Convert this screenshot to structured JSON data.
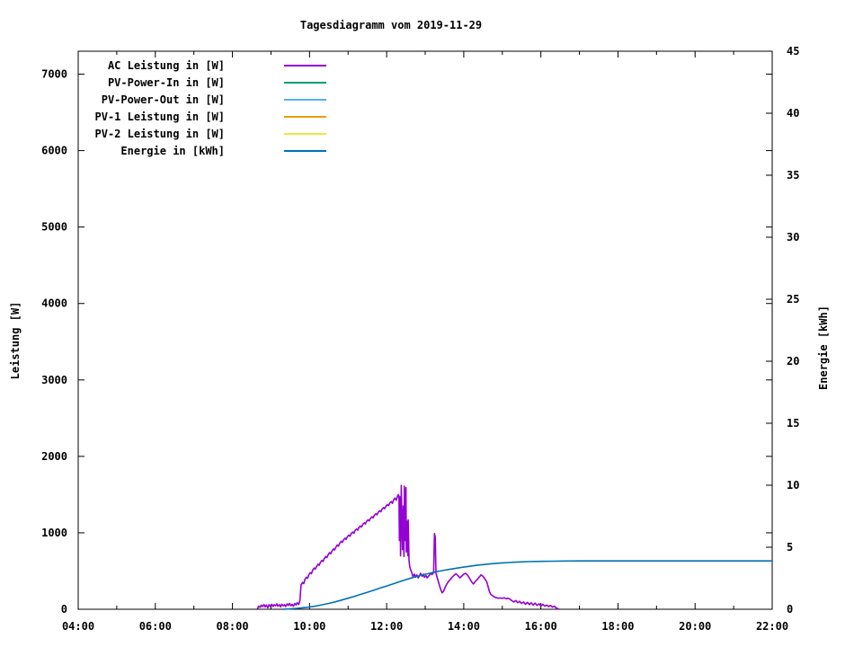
{
  "chart_data": {
    "type": "line",
    "title": "Tagesdiagramm vom 2019-11-29",
    "x_axis": {
      "ticks": [
        "04:00",
        "06:00",
        "08:00",
        "10:00",
        "12:00",
        "14:00",
        "16:00",
        "18:00",
        "20:00",
        "22:00"
      ],
      "range_hours": [
        4,
        22
      ],
      "minor_tick_interval_hours": 1,
      "grid": false
    },
    "y1_axis": {
      "label": "Leistung [W]",
      "ticks": [
        0,
        1000,
        2000,
        3000,
        4000,
        5000,
        6000,
        7000
      ],
      "range": [
        0,
        7300
      ]
    },
    "y2_axis": {
      "label": "Energie [kWh]",
      "ticks": [
        0,
        5,
        10,
        15,
        20,
        25,
        30,
        35,
        40,
        45
      ],
      "range": [
        0,
        45
      ]
    },
    "legend": [
      {
        "label": "AC Leistung in [W]",
        "color": "#9400d3"
      },
      {
        "label": "PV-Power-In in [W]",
        "color": "#009e73"
      },
      {
        "label": "PV-Power-Out in [W]",
        "color": "#56b4e9"
      },
      {
        "label": "PV-1 Leistung in [W]",
        "color": "#e69f00"
      },
      {
        "label": "PV-2 Leistung in [W]",
        "color": "#f0e442"
      },
      {
        "label": "Energie in [kWh]",
        "color": "#0072b2"
      }
    ],
    "legend_position": "top-left-inside",
    "plot": {
      "background": "#ffffff",
      "border_color": "#000000"
    },
    "series": [
      {
        "id": "ac",
        "name": "AC Leistung in [W]",
        "color": "#9400d3",
        "axis": "y1",
        "points": [
          [
            8.65,
            5
          ],
          [
            8.68,
            40
          ],
          [
            8.72,
            25
          ],
          [
            8.75,
            55
          ],
          [
            8.78,
            35
          ],
          [
            8.82,
            60
          ],
          [
            8.85,
            30
          ],
          [
            8.88,
            55
          ],
          [
            8.92,
            20
          ],
          [
            8.95,
            60
          ],
          [
            8.98,
            40
          ],
          [
            9.02,
            65
          ],
          [
            9.05,
            35
          ],
          [
            9.08,
            60
          ],
          [
            9.12,
            45
          ],
          [
            9.15,
            70
          ],
          [
            9.18,
            40
          ],
          [
            9.22,
            60
          ],
          [
            9.25,
            30
          ],
          [
            9.28,
            65
          ],
          [
            9.32,
            45
          ],
          [
            9.35,
            60
          ],
          [
            9.38,
            35
          ],
          [
            9.42,
            70
          ],
          [
            9.45,
            50
          ],
          [
            9.48,
            75
          ],
          [
            9.52,
            45
          ],
          [
            9.55,
            65
          ],
          [
            9.58,
            40
          ],
          [
            9.62,
            75
          ],
          [
            9.65,
            55
          ],
          [
            9.68,
            85
          ],
          [
            9.72,
            65
          ],
          [
            9.75,
            110
          ],
          [
            9.78,
            320
          ],
          [
            9.82,
            350
          ],
          [
            9.85,
            335
          ],
          [
            9.88,
            390
          ],
          [
            9.92,
            420
          ],
          [
            9.95,
            405
          ],
          [
            9.98,
            450
          ],
          [
            10.02,
            480
          ],
          [
            10.05,
            465
          ],
          [
            10.08,
            510
          ],
          [
            10.12,
            540
          ],
          [
            10.15,
            525
          ],
          [
            10.18,
            560
          ],
          [
            10.22,
            590
          ],
          [
            10.25,
            575
          ],
          [
            10.28,
            610
          ],
          [
            10.32,
            640
          ],
          [
            10.35,
            625
          ],
          [
            10.38,
            660
          ],
          [
            10.42,
            690
          ],
          [
            10.45,
            675
          ],
          [
            10.48,
            710
          ],
          [
            10.52,
            740
          ],
          [
            10.55,
            725
          ],
          [
            10.58,
            760
          ],
          [
            10.62,
            790
          ],
          [
            10.65,
            775
          ],
          [
            10.68,
            810
          ],
          [
            10.72,
            840
          ],
          [
            10.75,
            825
          ],
          [
            10.78,
            860
          ],
          [
            10.82,
            890
          ],
          [
            10.85,
            875
          ],
          [
            10.88,
            905
          ],
          [
            10.92,
            930
          ],
          [
            10.95,
            915
          ],
          [
            10.98,
            950
          ],
          [
            11.02,
            970
          ],
          [
            11.05,
            955
          ],
          [
            11.08,
            990
          ],
          [
            11.12,
            1010
          ],
          [
            11.15,
            995
          ],
          [
            11.18,
            1030
          ],
          [
            11.22,
            1050
          ],
          [
            11.25,
            1035
          ],
          [
            11.28,
            1070
          ],
          [
            11.32,
            1090
          ],
          [
            11.35,
            1075
          ],
          [
            11.38,
            1110
          ],
          [
            11.42,
            1130
          ],
          [
            11.45,
            1115
          ],
          [
            11.48,
            1150
          ],
          [
            11.52,
            1170
          ],
          [
            11.55,
            1155
          ],
          [
            11.58,
            1190
          ],
          [
            11.62,
            1210
          ],
          [
            11.65,
            1195
          ],
          [
            11.68,
            1230
          ],
          [
            11.72,
            1250
          ],
          [
            11.75,
            1235
          ],
          [
            11.78,
            1270
          ],
          [
            11.82,
            1290
          ],
          [
            11.85,
            1275
          ],
          [
            11.88,
            1310
          ],
          [
            11.92,
            1330
          ],
          [
            11.95,
            1315
          ],
          [
            11.98,
            1350
          ],
          [
            12.02,
            1370
          ],
          [
            12.05,
            1355
          ],
          [
            12.08,
            1390
          ],
          [
            12.12,
            1410
          ],
          [
            12.15,
            1385
          ],
          [
            12.18,
            1430
          ],
          [
            12.22,
            1455
          ],
          [
            12.25,
            1425
          ],
          [
            12.28,
            1475
          ],
          [
            12.3,
            1500
          ],
          [
            12.32,
            1480
          ],
          [
            12.33,
            900
          ],
          [
            12.35,
            1470
          ],
          [
            12.36,
            700
          ],
          [
            12.38,
            1620
          ],
          [
            12.4,
            1000
          ],
          [
            12.41,
            780
          ],
          [
            12.43,
            1350
          ],
          [
            12.45,
            690
          ],
          [
            12.46,
            1610
          ],
          [
            12.48,
            900
          ],
          [
            12.5,
            1590
          ],
          [
            12.51,
            750
          ],
          [
            12.53,
            1150
          ],
          [
            12.55,
            700
          ],
          [
            12.56,
            1170
          ],
          [
            12.58,
            640
          ],
          [
            12.6,
            560
          ],
          [
            12.62,
            520
          ],
          [
            12.65,
            480
          ],
          [
            12.68,
            430
          ],
          [
            12.72,
            460
          ],
          [
            12.75,
            420
          ],
          [
            12.78,
            450
          ],
          [
            12.82,
            410
          ],
          [
            12.85,
            440
          ],
          [
            12.88,
            470
          ],
          [
            12.92,
            430
          ],
          [
            12.95,
            460
          ],
          [
            12.98,
            420
          ],
          [
            13.02,
            440
          ],
          [
            13.05,
            410
          ],
          [
            13.08,
            430
          ],
          [
            13.12,
            450
          ],
          [
            13.15,
            470
          ],
          [
            13.18,
            455
          ],
          [
            13.22,
            480
          ],
          [
            13.24,
            990
          ],
          [
            13.26,
            940
          ],
          [
            13.28,
            470
          ],
          [
            13.32,
            400
          ],
          [
            13.36,
            330
          ],
          [
            13.4,
            260
          ],
          [
            13.44,
            215
          ],
          [
            13.48,
            240
          ],
          [
            13.52,
            290
          ],
          [
            13.56,
            330
          ],
          [
            13.6,
            360
          ],
          [
            13.65,
            390
          ],
          [
            13.7,
            420
          ],
          [
            13.75,
            445
          ],
          [
            13.8,
            465
          ],
          [
            13.85,
            440
          ],
          [
            13.9,
            410
          ],
          [
            13.95,
            435
          ],
          [
            14.0,
            460
          ],
          [
            14.05,
            470
          ],
          [
            14.1,
            445
          ],
          [
            14.15,
            405
          ],
          [
            14.2,
            360
          ],
          [
            14.25,
            330
          ],
          [
            14.3,
            365
          ],
          [
            14.35,
            390
          ],
          [
            14.4,
            420
          ],
          [
            14.45,
            450
          ],
          [
            14.5,
            430
          ],
          [
            14.55,
            395
          ],
          [
            14.6,
            355
          ],
          [
            14.63,
            300
          ],
          [
            14.66,
            240
          ],
          [
            14.7,
            195
          ],
          [
            14.75,
            175
          ],
          [
            14.8,
            160
          ],
          [
            14.85,
            150
          ],
          [
            14.9,
            145
          ],
          [
            14.95,
            148
          ],
          [
            15.0,
            142
          ],
          [
            15.05,
            150
          ],
          [
            15.1,
            138
          ],
          [
            15.15,
            145
          ],
          [
            15.2,
            130
          ],
          [
            15.25,
            110
          ],
          [
            15.3,
            95
          ],
          [
            15.35,
            115
          ],
          [
            15.4,
            85
          ],
          [
            15.45,
            105
          ],
          [
            15.5,
            75
          ],
          [
            15.55,
            95
          ],
          [
            15.6,
            65
          ],
          [
            15.65,
            90
          ],
          [
            15.7,
            60
          ],
          [
            15.75,
            85
          ],
          [
            15.8,
            55
          ],
          [
            15.85,
            80
          ],
          [
            15.9,
            50
          ],
          [
            15.95,
            70
          ],
          [
            16.0,
            45
          ],
          [
            16.05,
            65
          ],
          [
            16.1,
            40
          ],
          [
            16.15,
            55
          ],
          [
            16.2,
            35
          ],
          [
            16.25,
            50
          ],
          [
            16.3,
            28
          ],
          [
            16.35,
            40
          ],
          [
            16.4,
            18
          ],
          [
            16.45,
            5
          ],
          [
            16.47,
            0
          ]
        ]
      },
      {
        "id": "pv_in",
        "name": "PV-Power-In in [W]",
        "color": "#009e73",
        "axis": "y1",
        "points": []
      },
      {
        "id": "pv_out",
        "name": "PV-Power-Out in [W]",
        "color": "#56b4e9",
        "axis": "y1",
        "points": []
      },
      {
        "id": "pv1",
        "name": "PV-1 Leistung in [W]",
        "color": "#e69f00",
        "axis": "y1",
        "points": []
      },
      {
        "id": "pv2",
        "name": "PV-2 Leistung in [W]",
        "color": "#f0e442",
        "axis": "y1",
        "points": []
      },
      {
        "id": "energie",
        "name": "Energie in [kWh]",
        "color": "#0072b2",
        "axis": "y2",
        "points": [
          [
            9.33,
            0.01
          ],
          [
            9.5,
            0.03
          ],
          [
            9.67,
            0.07
          ],
          [
            9.83,
            0.12
          ],
          [
            10.0,
            0.18
          ],
          [
            10.17,
            0.26
          ],
          [
            10.33,
            0.36
          ],
          [
            10.5,
            0.47
          ],
          [
            10.67,
            0.6
          ],
          [
            10.83,
            0.74
          ],
          [
            11.0,
            0.89
          ],
          [
            11.17,
            1.04
          ],
          [
            11.33,
            1.2
          ],
          [
            11.5,
            1.37
          ],
          [
            11.67,
            1.54
          ],
          [
            11.83,
            1.71
          ],
          [
            12.0,
            1.88
          ],
          [
            12.17,
            2.05
          ],
          [
            12.33,
            2.22
          ],
          [
            12.5,
            2.39
          ],
          [
            12.67,
            2.55
          ],
          [
            12.83,
            2.69
          ],
          [
            13.0,
            2.82
          ],
          [
            13.17,
            2.94
          ],
          [
            13.33,
            3.05
          ],
          [
            13.5,
            3.15
          ],
          [
            13.67,
            3.24
          ],
          [
            13.83,
            3.32
          ],
          [
            14.0,
            3.4
          ],
          [
            14.17,
            3.47
          ],
          [
            14.33,
            3.54
          ],
          [
            14.5,
            3.6
          ],
          [
            14.67,
            3.65
          ],
          [
            14.83,
            3.7
          ],
          [
            15.0,
            3.74
          ],
          [
            15.17,
            3.77
          ],
          [
            15.33,
            3.8
          ],
          [
            15.5,
            3.82
          ],
          [
            15.67,
            3.84
          ],
          [
            16.0,
            3.86
          ],
          [
            16.33,
            3.88
          ],
          [
            16.67,
            3.89
          ],
          [
            17.0,
            3.9
          ],
          [
            18.0,
            3.9
          ],
          [
            19.0,
            3.9
          ],
          [
            20.0,
            3.9
          ],
          [
            21.0,
            3.9
          ],
          [
            22.0,
            3.9
          ]
        ]
      }
    ]
  }
}
